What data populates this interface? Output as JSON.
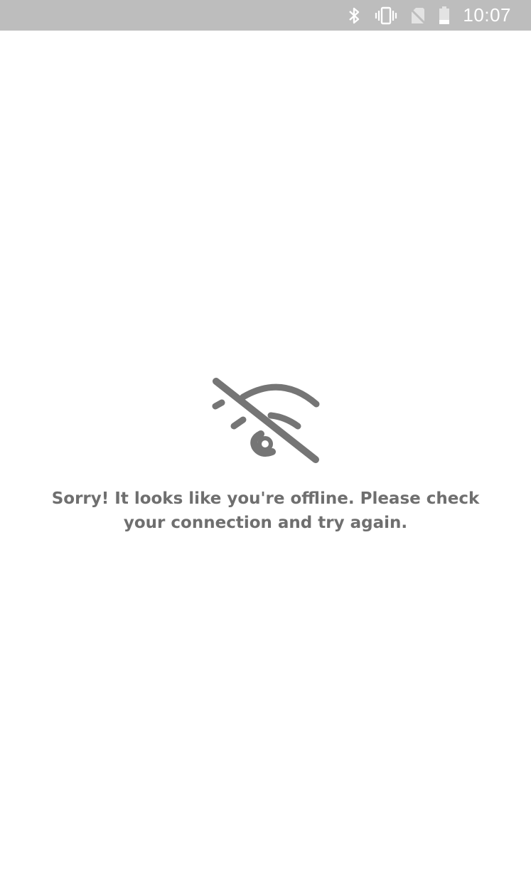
{
  "status_bar": {
    "time": "10:07",
    "icons": [
      "bluetooth-icon",
      "vibrate-icon",
      "no-sim-icon",
      "battery-icon"
    ]
  },
  "offline": {
    "icon": "wifi-off-icon",
    "message": "Sorry! It looks like you're offline. Please check your connection and try again."
  }
}
